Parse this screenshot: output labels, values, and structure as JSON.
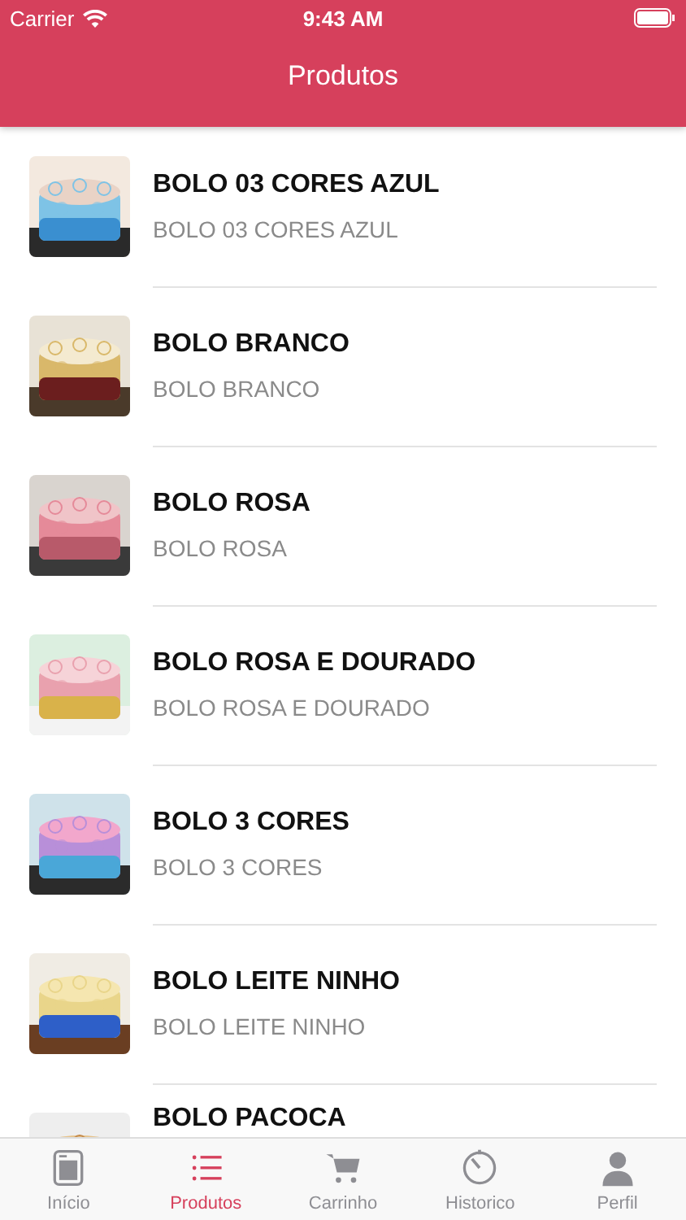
{
  "status_bar": {
    "carrier": "Carrier",
    "time": "9:43 AM"
  },
  "nav": {
    "title": "Produtos"
  },
  "products": [
    {
      "name": "BOLO 03 CORES AZUL",
      "description": "BOLO 03 CORES AZUL",
      "kind": "picture"
    },
    {
      "name": "BOLO BRANCO",
      "description": "BOLO BRANCO",
      "kind": "picture"
    },
    {
      "name": "BOLO ROSA",
      "description": "BOLO ROSA",
      "kind": "picture"
    },
    {
      "name": "BOLO ROSA E DOURADO",
      "description": "BOLO ROSA E DOURADO",
      "kind": "picture"
    },
    {
      "name": "BOLO 3 CORES",
      "description": "BOLO 3 CORES",
      "kind": "picture"
    },
    {
      "name": "BOLO LEITE NINHO",
      "description": "BOLO LEITE NINHO",
      "kind": "picture"
    },
    {
      "name": "BOLO PACOCA",
      "kind": "picture"
    }
  ],
  "tabs": [
    {
      "label": "Início",
      "selected": false
    },
    {
      "label": "Produtos",
      "selected": true
    },
    {
      "label": "Carrinho",
      "selected": false
    },
    {
      "label": "Historico",
      "selected": false
    },
    {
      "label": "Perfil",
      "selected": false
    }
  ]
}
